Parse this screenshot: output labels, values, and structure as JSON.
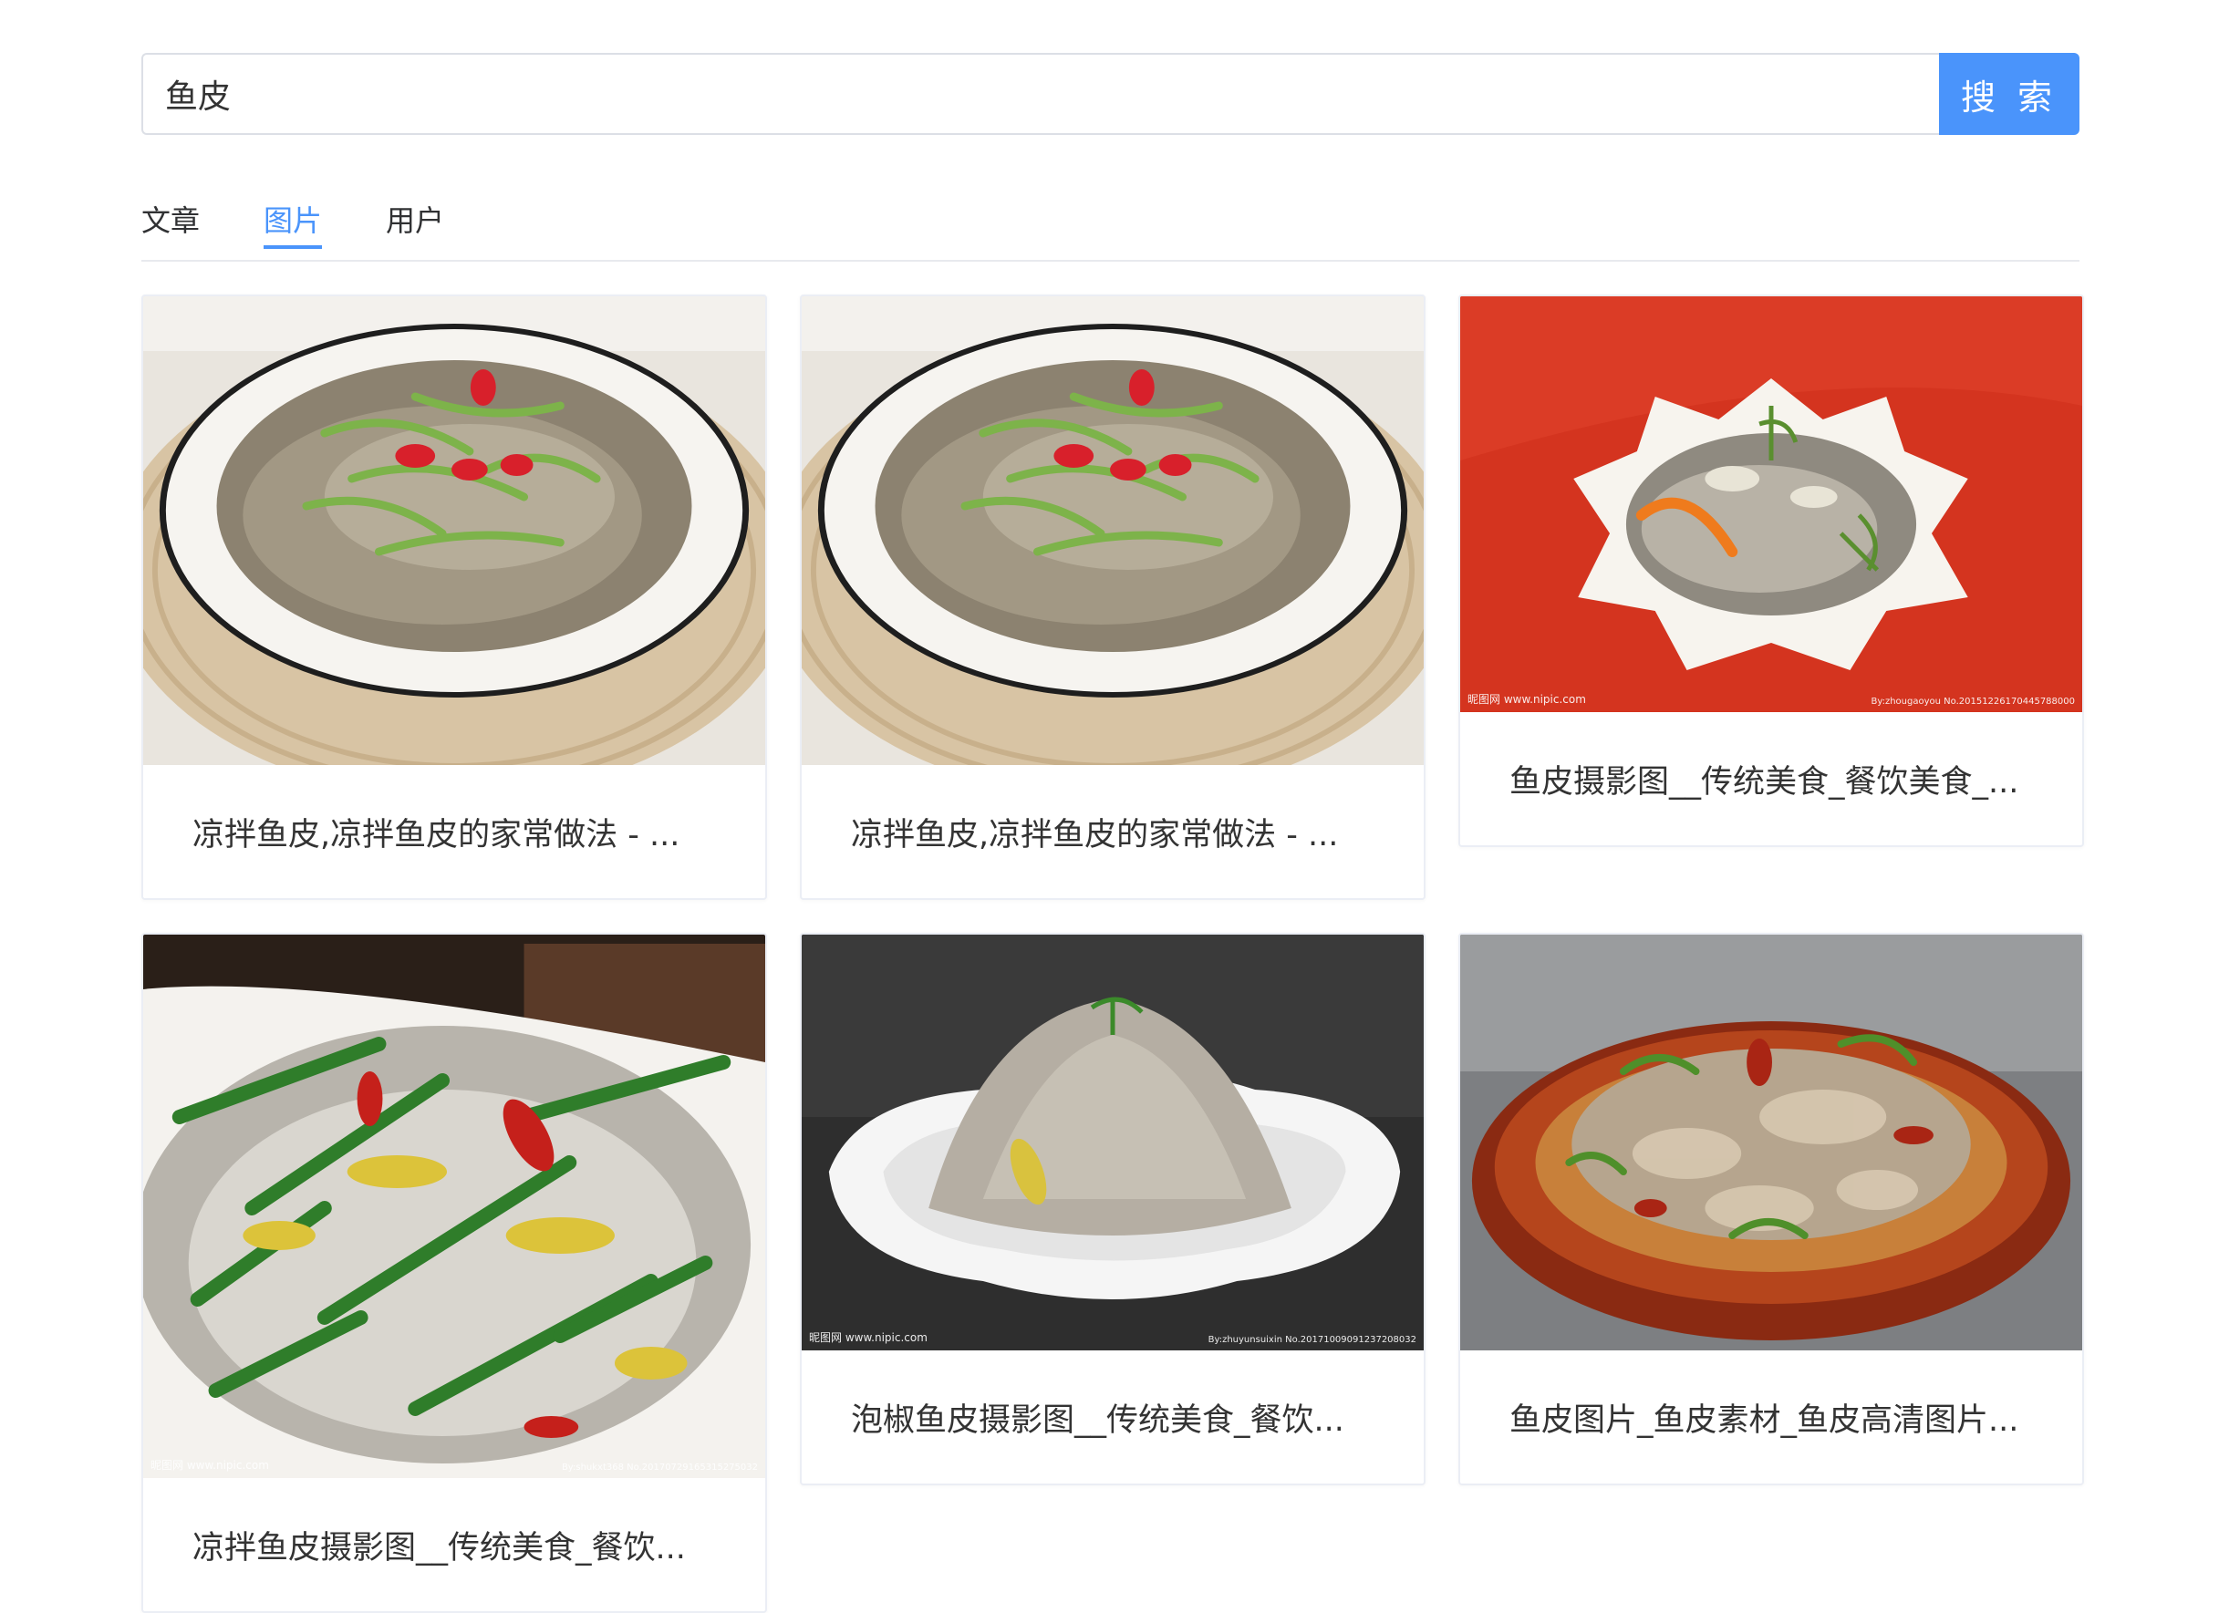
{
  "search": {
    "value": "鱼皮",
    "button_label": "搜 索"
  },
  "tabs": [
    {
      "label": "文章",
      "active": false
    },
    {
      "label": "图片",
      "active": true
    },
    {
      "label": "用户",
      "active": false
    }
  ],
  "results": [
    {
      "title": "凉拌鱼皮,凉拌鱼皮的家常做法 - ..."
    },
    {
      "title": "凉拌鱼皮,凉拌鱼皮的家常做法 - ..."
    },
    {
      "title": "鱼皮摄影图__传统美食_餐饮美食_...",
      "watermark_left": "昵图网 www.nipic.com",
      "watermark_right": "By:zhougaoyou No.20151226170445788000"
    },
    {
      "title": "凉拌鱼皮摄影图__传统美食_餐饮...",
      "watermark_left": "昵图网 www.nipic.com",
      "watermark_right": "By:shukxt368 No.20170729165315275032"
    },
    {
      "title": "泡椒鱼皮摄影图__传统美食_餐饮...",
      "watermark_left": "昵图网 www.nipic.com",
      "watermark_right": "By:zhuyunsuixin No.20171009091237208032"
    },
    {
      "title": "鱼皮图片_鱼皮素材_鱼皮高清图片..."
    }
  ],
  "colors": {
    "accent": "#4a94fb",
    "border": "#dcdfe6"
  }
}
